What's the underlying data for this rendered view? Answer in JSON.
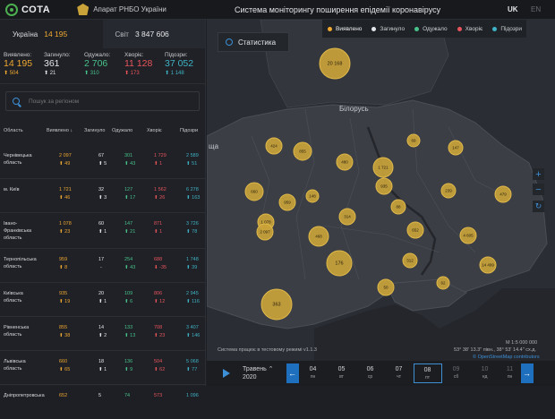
{
  "header": {
    "logo_text": "СОТА",
    "org": "Апарат РНБО України",
    "title": "Система моніторингу поширення епідемії коронавірусу",
    "lang_active": "UK",
    "lang_other": "EN"
  },
  "country_tabs": [
    {
      "label": "Україна",
      "value": "14 195"
    },
    {
      "label": "Світ",
      "value": "3 847 606"
    }
  ],
  "stats": [
    {
      "label": "Виявлено:",
      "value": "14 195",
      "delta": "504",
      "color": "#f0a830"
    },
    {
      "label": "Загинуло:",
      "value": "361",
      "delta": "21",
      "color": "#e3e5e8"
    },
    {
      "label": "Одужало:",
      "value": "2 706",
      "delta": "310",
      "color": "#47c28a"
    },
    {
      "label": "Хворіє:",
      "value": "11 128",
      "delta": "173",
      "color": "#e8545c"
    },
    {
      "label": "Підозри:",
      "value": "37 052",
      "delta": "1 148",
      "color": "#3fb3c5"
    }
  ],
  "search": {
    "placeholder": "Пошук за регіоном"
  },
  "table": {
    "headers": [
      "Область",
      "Виявлено ↓",
      "Загинуло",
      "Одужало",
      "Хворіє",
      "Підозри"
    ],
    "rows": [
      {
        "region": "Чернівецька область",
        "detected": "2 097",
        "d_detected": "49",
        "dead": "67",
        "d_dead": "5",
        "recovered": "301",
        "d_recovered": "43",
        "ill": "1 729",
        "d_ill": "1",
        "suspect": "2 589",
        "d_suspect": "51"
      },
      {
        "region": "м. Київ",
        "detected": "1 721",
        "d_detected": "46",
        "dead": "32",
        "d_dead": "3",
        "recovered": "127",
        "d_recovered": "17",
        "ill": "1 562",
        "d_ill": "26",
        "suspect": "6 278",
        "d_suspect": "163"
      },
      {
        "region": "Івано-Франківська область",
        "detected": "1 078",
        "d_detected": "23",
        "dead": "60",
        "d_dead": "1",
        "recovered": "147",
        "d_recovered": "21",
        "ill": "871",
        "d_ill": "1",
        "suspect": "3 726",
        "d_suspect": "78"
      },
      {
        "region": "Тернопільська область",
        "detected": "959",
        "d_detected": "8",
        "dead": "17",
        "d_dead": "-",
        "recovered": "254",
        "d_recovered": "43",
        "ill": "688",
        "d_ill": "-35",
        "suspect": "1 748",
        "d_suspect": "39"
      },
      {
        "region": "Київська область",
        "detected": "935",
        "d_detected": "19",
        "dead": "20",
        "d_dead": "1",
        "recovered": "109",
        "d_recovered": "6",
        "ill": "806",
        "d_ill": "12",
        "suspect": "2 945",
        "d_suspect": "116"
      },
      {
        "region": "Рівненська область",
        "detected": "855",
        "d_detected": "38",
        "dead": "14",
        "d_dead": "2",
        "recovered": "133",
        "d_recovered": "13",
        "ill": "708",
        "d_ill": "23",
        "suspect": "3 407",
        "d_suspect": "146"
      },
      {
        "region": "Львівська область",
        "detected": "660",
        "d_detected": "65",
        "dead": "18",
        "d_dead": "1",
        "recovered": "136",
        "d_recovered": "9",
        "ill": "504",
        "d_ill": "62",
        "suspect": "5 068",
        "d_suspect": "77"
      },
      {
        "region": "Дніпропетровська",
        "detected": "652",
        "d_detected": "",
        "dead": "5",
        "d_dead": "",
        "recovered": "74",
        "d_recovered": "",
        "ill": "573",
        "d_ill": "",
        "suspect": "1 096",
        "d_suspect": ""
      }
    ]
  },
  "map": {
    "stats_button": "Статистика",
    "legend": [
      {
        "label": "Виявлено",
        "color": "#f0a830",
        "active": true
      },
      {
        "label": "Загинуло",
        "color": "#e3e5e8",
        "active": false
      },
      {
        "label": "Одужало",
        "color": "#47c28a",
        "active": false
      },
      {
        "label": "Хворіє",
        "color": "#e8545c",
        "active": false
      },
      {
        "label": "Підозри",
        "color": "#3fb3c5",
        "active": false
      }
    ],
    "label_belarus": "Білорусь",
    "label_cut": "ща",
    "scale": "M 1:5 000 000",
    "coords": "53° 38' 13.3\" півн., 38° 53' 14.4\" сх.д.",
    "attribution": "© OpenStreetMap contributors",
    "test_mode": "Система працює в тестовому режимі v1.1.3",
    "bubbles": [
      "20 168",
      "424",
      "855",
      "480",
      "1 721",
      "935",
      "69",
      "147",
      "660",
      "959",
      "148",
      "239",
      "479",
      "1 078",
      "314",
      "88",
      "2 097",
      "468",
      "652",
      "4 605",
      "176",
      "312",
      "14 499",
      "363",
      "50",
      "62"
    ]
  },
  "timeline": {
    "month": "Травень",
    "year": "2020",
    "days": [
      {
        "d": "04",
        "w": "пн"
      },
      {
        "d": "05",
        "w": "вт"
      },
      {
        "d": "06",
        "w": "ср"
      },
      {
        "d": "07",
        "w": "чт"
      },
      {
        "d": "08",
        "w": "пт"
      },
      {
        "d": "09",
        "w": "сб"
      },
      {
        "d": "10",
        "w": "нд"
      },
      {
        "d": "11",
        "w": "пн"
      }
    ]
  }
}
